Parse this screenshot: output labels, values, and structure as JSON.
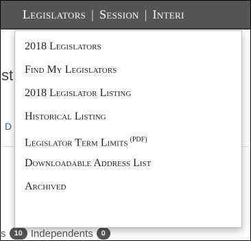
{
  "nav": {
    "items": [
      {
        "label": "Legislators"
      },
      {
        "label": "Session"
      },
      {
        "label": "Interi"
      }
    ],
    "separator": "|"
  },
  "dropdown": {
    "items": [
      {
        "label": "2018 Legislators",
        "suffix": ""
      },
      {
        "label": "Find My Legislators",
        "suffix": ""
      },
      {
        "label": "2018 Legislator Listing",
        "suffix": ""
      },
      {
        "label": "Historical Listing",
        "suffix": ""
      },
      {
        "label": "Legislator Term Limits",
        "suffix": "(PDF)"
      },
      {
        "label": "Downloadable Address List",
        "suffix": ""
      },
      {
        "label": "Archived",
        "suffix": ""
      }
    ]
  },
  "background": {
    "heading_fragment": "st",
    "link_fragment": "D",
    "counts": {
      "prev_suffix": "s",
      "prev_count": "10",
      "independents_label": "Independents",
      "independents_count": "0"
    }
  },
  "colors": {
    "navbar_bg": "#555555",
    "badge_bg": "#555555",
    "link": "#2a5aa8"
  }
}
